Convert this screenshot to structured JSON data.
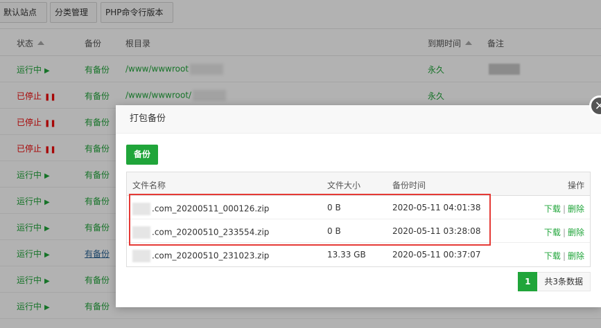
{
  "toolbar": {
    "default_site": "默认站点",
    "category": "分类管理",
    "php_cli": "PHP命令行版本"
  },
  "sites_table": {
    "headers": {
      "status": "状态",
      "backup": "备份",
      "root": "根目录",
      "expire": "到期时间",
      "note": "备注"
    },
    "rows": [
      {
        "status": "运行中",
        "status_icon": "play-icon",
        "backup": "有备份",
        "path": "/www/wwwroot",
        "expire": "永久"
      },
      {
        "status": "已停止",
        "status_icon": "pause-icon",
        "backup": "有备份",
        "path": "/www/wwwroot/",
        "expire": "永久"
      },
      {
        "status": "已停止",
        "status_icon": "pause-icon",
        "backup": "有备份",
        "path": "",
        "expire": ""
      },
      {
        "status": "已停止",
        "status_icon": "pause-icon",
        "backup": "有备份",
        "path": "",
        "expire": ""
      },
      {
        "status": "运行中",
        "status_icon": "play-icon",
        "backup": "有备份",
        "path": "",
        "expire": ""
      },
      {
        "status": "运行中",
        "status_icon": "play-icon",
        "backup": "有备份",
        "path": "",
        "expire": ""
      },
      {
        "status": "运行中",
        "status_icon": "play-icon",
        "backup": "有备份",
        "path": "",
        "expire": ""
      },
      {
        "status": "运行中",
        "status_icon": "play-icon",
        "backup": "有备份",
        "path": "",
        "expire": ""
      },
      {
        "status": "运行中",
        "status_icon": "play-icon",
        "backup": "有备份",
        "path": "",
        "expire": ""
      },
      {
        "status": "运行中",
        "status_icon": "play-icon",
        "backup": "有备份",
        "path": "",
        "expire": ""
      }
    ]
  },
  "modal": {
    "title": "打包备份",
    "close_icon": "close-icon",
    "backup_button": "备份",
    "table_headers": {
      "name": "文件名称",
      "size": "文件大小",
      "time": "备份时间",
      "ops": "操作"
    },
    "rows": [
      {
        "name": ".com_20200511_000126.zip",
        "size": "0 B",
        "time": "2020-05-11 04:01:38",
        "download": "下载",
        "delete": "删除"
      },
      {
        "name": ".com_20200510_233554.zip",
        "size": "0 B",
        "time": "2020-05-11 03:28:08",
        "download": "下载",
        "delete": "删除"
      },
      {
        "name": ".com_20200510_231023.zip",
        "size": "13.33 GB",
        "time": "2020-05-11 00:37:07",
        "download": "下载",
        "delete": "删除"
      }
    ],
    "op_separator": "|",
    "pagination": {
      "current": "1",
      "total": "共3条数据"
    }
  },
  "colors": {
    "accent": "#20a53a",
    "stopped": "#ef0808",
    "highlight": "#e53935"
  }
}
